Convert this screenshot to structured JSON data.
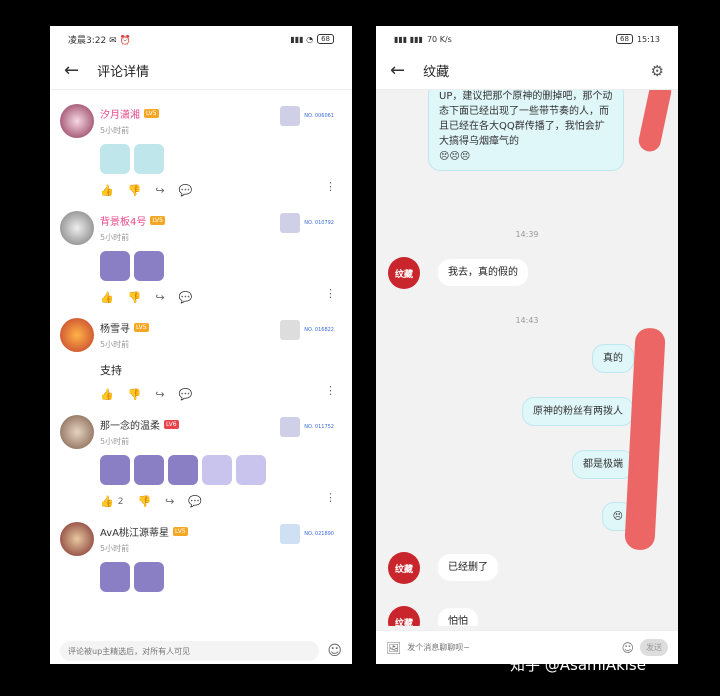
{
  "left": {
    "status": {
      "time": "凌晨3:22",
      "icons": "✉ ⏰",
      "signal": "▮▮▮ ◔",
      "battery": "68"
    },
    "title": "评论详情",
    "comments": [
      {
        "name": "汐月潇湘",
        "level": "LV5",
        "time": "5小时前",
        "fan_no": "NO. 006061"
      },
      {
        "name": "背景板4号",
        "level": "LV5",
        "time": "5小时前",
        "fan_no": "NO. 010792"
      },
      {
        "name": "杨雪寻",
        "level": "LV5",
        "time": "5小时前",
        "fan_no": "NO. 016822",
        "text": "支持"
      },
      {
        "name": "那一念的温柔",
        "level": "LV6",
        "time": "5小时前",
        "fan_no": "NO. 011752",
        "likes": "2"
      },
      {
        "name": "AvA桃江源蒂星",
        "level": "LV5",
        "time": "5小时前",
        "fan_no": "NO. 021890"
      }
    ],
    "input_placeholder": "评论被up主精选后，对所有人可见"
  },
  "right": {
    "status": {
      "signal": "▮▮▮ ▮▮▮",
      "speed": "70 K/s",
      "battery": "68",
      "time": "15:13"
    },
    "title": "纹藏",
    "messages": {
      "m1": "UP，建议把那个原神的删掉吧，那个动态下面已经出现了一些带节奏的人，而且已经在各大QQ群传播了，我怕会扩大搞得乌烟瘴气的",
      "m1_emojis": "😣😣😣",
      "t1": "14:39",
      "m2": "我去，真的假的",
      "t2": "14:43",
      "m3": "真的",
      "m4": "原神的粉丝有两拨人",
      "m5": "都是极端",
      "m6": "😣",
      "m7": "已经删了",
      "m8": "怕怕"
    },
    "avatar_text": "纹藏",
    "input_placeholder": "发个消息聊聊呗~",
    "send_label": "发送"
  },
  "watermark": "知乎 @AsamiAkise",
  "colors": {
    "accent_pink": "#e84a8a",
    "chat_mine": "#e0f7fa",
    "avatar_red": "#c9252c",
    "scribble": "#ec5a5a"
  }
}
